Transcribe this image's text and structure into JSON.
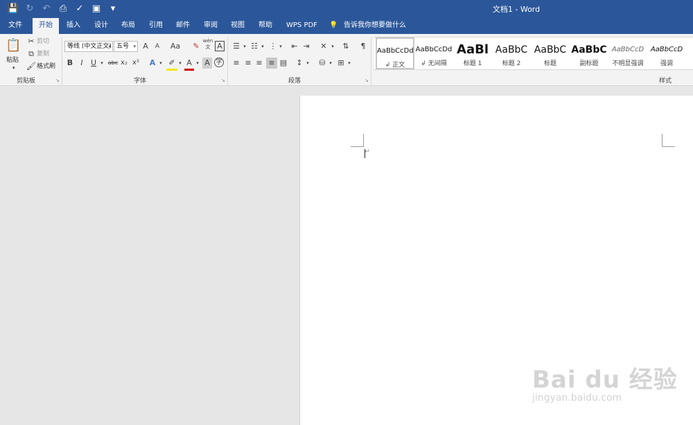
{
  "window": {
    "title": "文档1  -  Word"
  },
  "tabs": [
    {
      "label": "文件"
    },
    {
      "label": "开始"
    },
    {
      "label": "插入"
    },
    {
      "label": "设计"
    },
    {
      "label": "布局"
    },
    {
      "label": "引用"
    },
    {
      "label": "邮件"
    },
    {
      "label": "审阅"
    },
    {
      "label": "视图"
    },
    {
      "label": "帮助"
    },
    {
      "label": "WPS PDF"
    }
  ],
  "tell_me": {
    "placeholder": "告诉我你想要做什么"
  },
  "clipboard": {
    "paste": "粘贴",
    "cut": "剪切",
    "copy": "复制",
    "format_painter": "格式刷",
    "group_label": "剪贴板"
  },
  "font": {
    "name": "等线 (中文正文)",
    "size": "五号",
    "case_label": "Aa",
    "group_label": "字体",
    "phonetic": "wén\n文",
    "bold": "B",
    "italic": "I",
    "underline": "U",
    "strike": "abc",
    "sub": "x₂",
    "sup": "x²",
    "grow": "A",
    "shrink": "A",
    "char_border": "A",
    "shading": "A",
    "text_color": "A"
  },
  "paragraph": {
    "group_label": "段落"
  },
  "styles": {
    "group_label": "样式",
    "items": [
      {
        "preview": "AaBbCcDd",
        "name": "正文"
      },
      {
        "preview": "AaBbCcDd",
        "name": "无间隔"
      },
      {
        "preview": "AaBl",
        "name": "标题 1"
      },
      {
        "preview": "AaBbC",
        "name": "标题 2"
      },
      {
        "preview": "AaBbC",
        "name": "标题"
      },
      {
        "preview": "AaBbC",
        "name": "副标题"
      },
      {
        "preview": "AaBbCcD",
        "name": "不明显强调"
      },
      {
        "preview": "AaBbCcD",
        "name": "强调"
      }
    ]
  },
  "watermark": {
    "brand": "Bai du 经验",
    "url": "jingyan.baidu.com"
  },
  "colors": {
    "brand": "#2b579a",
    "ribbon": "#f3f3f3",
    "workspace": "#e6e6e6"
  }
}
